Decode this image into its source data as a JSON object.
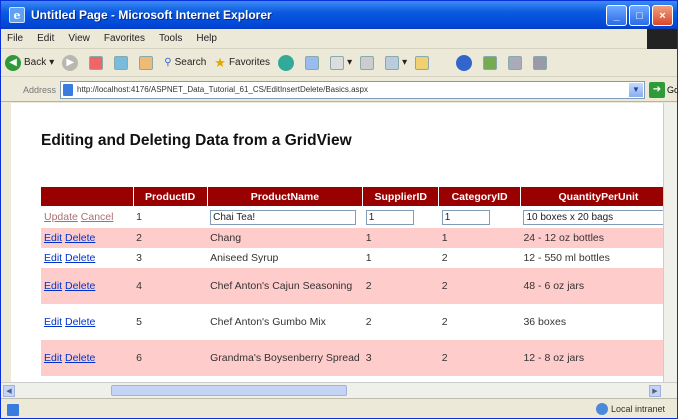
{
  "window": {
    "title": "Untitled Page - Microsoft Internet Explorer"
  },
  "menu": [
    "File",
    "Edit",
    "View",
    "Favorites",
    "Tools",
    "Help"
  ],
  "toolbar": {
    "back": "Back",
    "search": "Search",
    "favorites": "Favorites"
  },
  "address": {
    "label": "Address",
    "url": "http://localhost:4176/ASPNET_Data_Tutorial_61_CS/EditInsertDelete/Basics.aspx",
    "go": "Go"
  },
  "page": {
    "title": "Editing and Deleting Data from a GridView"
  },
  "grid": {
    "columns": [
      "",
      "ProductID",
      "ProductName",
      "SupplierID",
      "CategoryID",
      "QuantityPerUnit"
    ],
    "edit_row": {
      "update": "Update",
      "cancel": "Cancel",
      "product_id": "1",
      "product_name": "Chai Tea!",
      "supplier_id": "1",
      "category_id": "1",
      "qty": "10 boxes x 20 bags"
    },
    "rows": [
      {
        "edit": "Edit",
        "delete": "Delete",
        "product_id": "2",
        "product_name": "Chang",
        "supplier_id": "1",
        "category_id": "1",
        "qty": "24 - 12 oz bottles"
      },
      {
        "edit": "Edit",
        "delete": "Delete",
        "product_id": "3",
        "product_name": "Aniseed Syrup",
        "supplier_id": "1",
        "category_id": "2",
        "qty": "12 - 550 ml bottles"
      },
      {
        "edit": "Edit",
        "delete": "Delete",
        "product_id": "4",
        "product_name": "Chef Anton's Cajun Seasoning",
        "supplier_id": "2",
        "category_id": "2",
        "qty": "48 - 6 oz jars"
      },
      {
        "edit": "Edit",
        "delete": "Delete",
        "product_id": "5",
        "product_name": "Chef Anton's Gumbo Mix",
        "supplier_id": "2",
        "category_id": "2",
        "qty": "36 boxes"
      },
      {
        "edit": "Edit",
        "delete": "Delete",
        "product_id": "6",
        "product_name": "Grandma's Boysenberry Spread",
        "supplier_id": "3",
        "category_id": "2",
        "qty": "12 - 8 oz jars"
      }
    ]
  },
  "status": {
    "zone": "Local intranet"
  },
  "colors": {
    "header": "#990000",
    "alt_row": "#ffcccc",
    "link": "#0033cc"
  }
}
